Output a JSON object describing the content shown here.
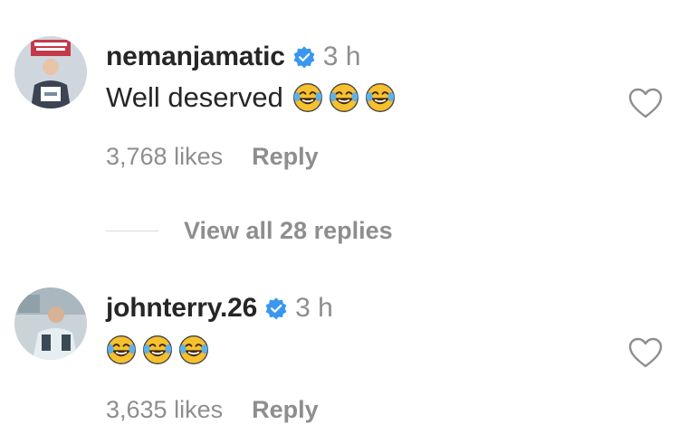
{
  "comments": [
    {
      "username": "nemanjamatic",
      "time": "3 h",
      "text": "Well deserved",
      "emojis": [
        "face-with-tears-of-joy",
        "face-with-tears-of-joy",
        "face-with-tears-of-joy"
      ],
      "likes": "3,768 likes",
      "reply": "Reply"
    },
    {
      "username": "johnterry.26",
      "time": "3 h",
      "text": "",
      "emojis": [
        "face-with-tears-of-joy",
        "face-with-tears-of-joy",
        "face-with-tears-of-joy"
      ],
      "likes": "3,635 likes",
      "reply": "Reply"
    }
  ],
  "view_replies": "View all 28 replies",
  "colors": {
    "verified": "#3897f0",
    "muted": "#8e8e8e",
    "text": "#262626",
    "emoji": "#f7c02f"
  },
  "icons": [
    "verified-badge-icon",
    "heart-outline-icon",
    "face-with-tears-of-joy-icon"
  ]
}
